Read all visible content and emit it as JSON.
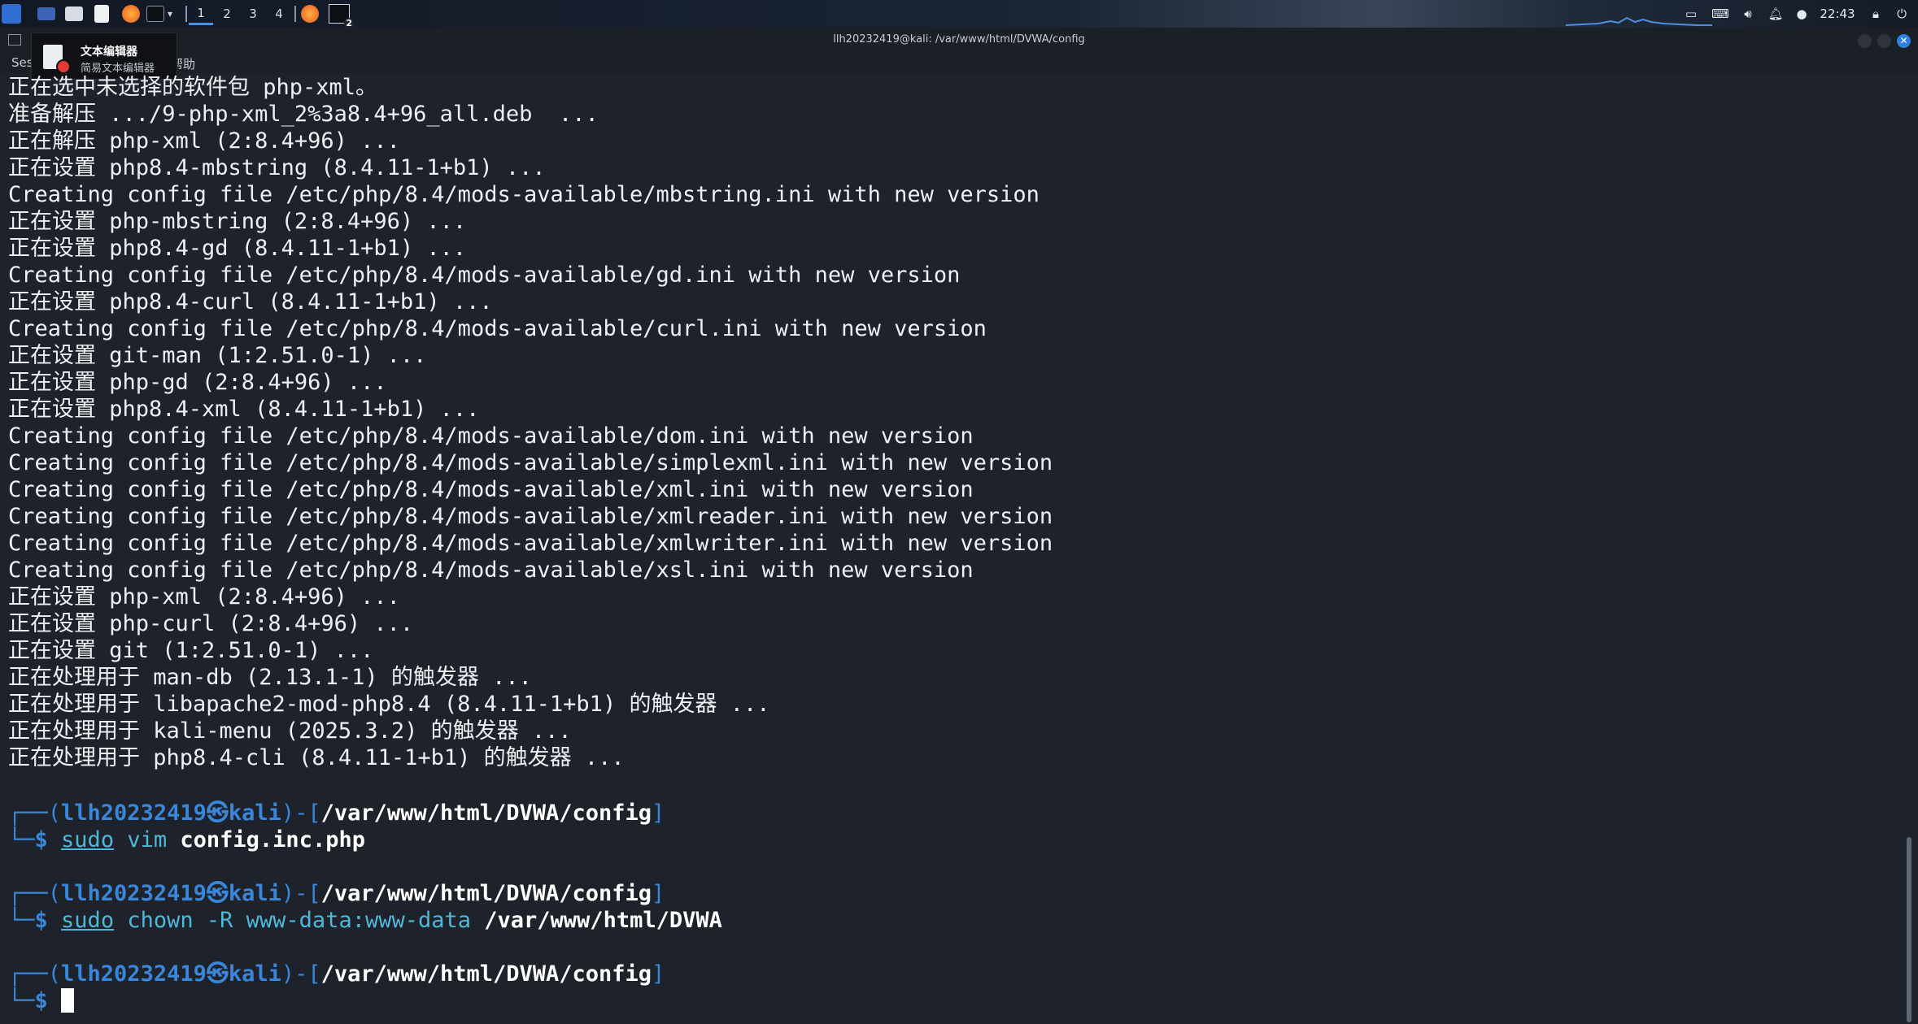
{
  "taskbar": {
    "workspaces": [
      "1",
      "2",
      "3",
      "4"
    ],
    "active_workspace": "1",
    "terminal_badge": "2",
    "clock": "22:43",
    "apps": [
      "kali-menu-icon",
      "desktop-icon",
      "file-manager-icon",
      "text-editor-icon",
      "firefox-icon",
      "terminal-icon"
    ]
  },
  "window": {
    "title": "llh20232419@kali: /var/www/html/DVWA/config",
    "menu": [
      "Ses",
      "帮助"
    ]
  },
  "tooltip": {
    "title": "文本编辑器",
    "subtitle": "简易文本编辑器"
  },
  "terminal": {
    "output_lines": [
      "正在选中未选择的软件包 php-xml。",
      "准备解压 .../9-php-xml_2%3a8.4+96_all.deb  ...",
      "正在解压 php-xml (2:8.4+96) ...",
      "正在设置 php8.4-mbstring (8.4.11-1+b1) ...",
      "Creating config file /etc/php/8.4/mods-available/mbstring.ini with new version",
      "正在设置 php-mbstring (2:8.4+96) ...",
      "正在设置 php8.4-gd (8.4.11-1+b1) ...",
      "Creating config file /etc/php/8.4/mods-available/gd.ini with new version",
      "正在设置 php8.4-curl (8.4.11-1+b1) ...",
      "Creating config file /etc/php/8.4/mods-available/curl.ini with new version",
      "正在设置 git-man (1:2.51.0-1) ...",
      "正在设置 php-gd (2:8.4+96) ...",
      "正在设置 php8.4-xml (8.4.11-1+b1) ...",
      "Creating config file /etc/php/8.4/mods-available/dom.ini with new version",
      "Creating config file /etc/php/8.4/mods-available/simplexml.ini with new version",
      "Creating config file /etc/php/8.4/mods-available/xml.ini with new version",
      "Creating config file /etc/php/8.4/mods-available/xmlreader.ini with new version",
      "Creating config file /etc/php/8.4/mods-available/xmlwriter.ini with new version",
      "Creating config file /etc/php/8.4/mods-available/xsl.ini with new version",
      "正在设置 php-xml (2:8.4+96) ...",
      "正在设置 php-curl (2:8.4+96) ...",
      "正在设置 git (1:2.51.0-1) ...",
      "正在处理用于 man-db (2.13.1-1) 的触发器 ...",
      "正在处理用于 libapache2-mod-php8.4 (8.4.11-1+b1) 的触发器 ...",
      "正在处理用于 kali-menu (2025.3.2) 的触发器 ...",
      "正在处理用于 php8.4-cli (8.4.11-1+b1) 的触发器 ..."
    ],
    "prompt": {
      "open": "┌──(",
      "user": "llh20232419㉿kali",
      "mid": ")-[",
      "cwd": "/var/www/html/DVWA/config",
      "close": "]",
      "corner": "└─",
      "dollar": "$"
    },
    "commands": [
      {
        "sudo": "sudo",
        "cmd": "vim",
        "args": "",
        "path": "config.inc.php"
      },
      {
        "sudo": "sudo",
        "cmd": "chown",
        "args": "-R www-data:www-data",
        "path": "/var/www/html/DVWA"
      }
    ]
  }
}
